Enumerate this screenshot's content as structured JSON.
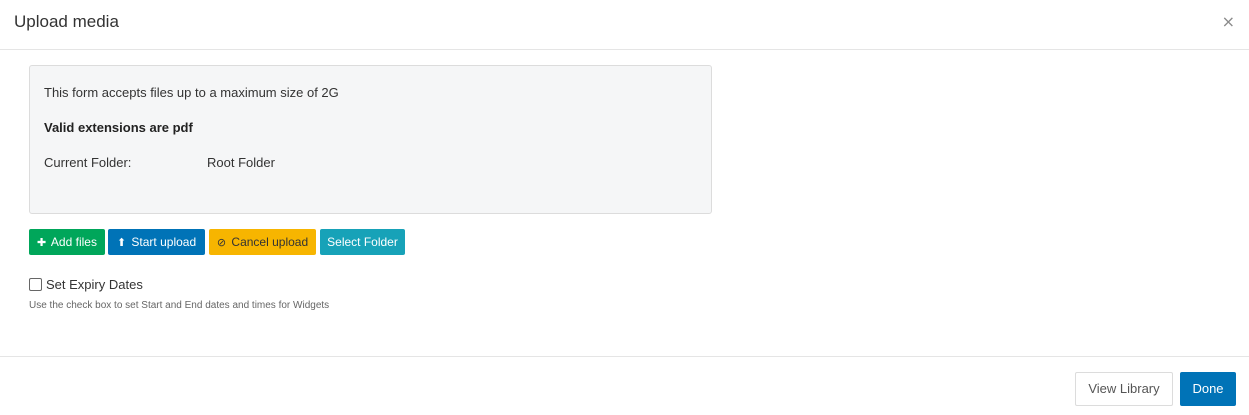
{
  "header": {
    "title": "Upload media",
    "close_glyph": "×"
  },
  "info": {
    "size_text": "This form accepts files up to a maximum size of 2G",
    "extensions_text": "Valid extensions are pdf",
    "folder_label": "Current Folder:",
    "folder_value": "Root Folder"
  },
  "buttons": {
    "add_files": {
      "icon": "plus-icon",
      "glyph": "✚",
      "label": "Add files",
      "color": "#00a65a"
    },
    "start_upload": {
      "icon": "upload-icon",
      "glyph": "⬆",
      "label": "Start upload",
      "color": "#0073b7"
    },
    "cancel_upload": {
      "icon": "ban-icon",
      "glyph": "⊘",
      "label": "Cancel upload",
      "color": "#f7b500"
    },
    "select_folder": {
      "label": "Select Folder",
      "color": "#17a2b8"
    }
  },
  "expiry": {
    "checked": false,
    "label": "Set Expiry Dates",
    "help": "Use the check box to set Start and End dates and times for Widgets"
  },
  "footer": {
    "view_library": "View Library",
    "done": "Done"
  }
}
